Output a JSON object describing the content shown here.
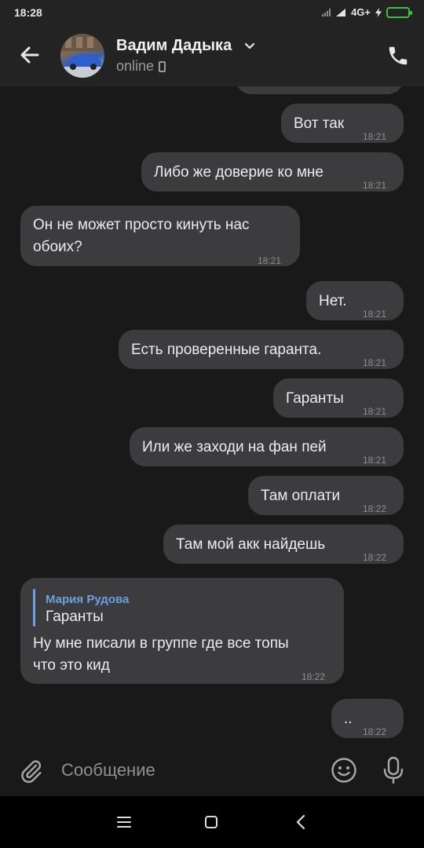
{
  "status_bar": {
    "time": "18:28",
    "network": "4G+"
  },
  "header": {
    "contact_name": "Вадим Дадыка",
    "status": "online"
  },
  "messages": [
    {
      "id": "m1",
      "direction": "out",
      "text": "Вот так",
      "time": "18:21"
    },
    {
      "id": "m2",
      "direction": "out",
      "text": "Либо же доверие ко мне",
      "time": "18:21"
    },
    {
      "id": "m3",
      "direction": "in",
      "text_lines": [
        "Он не может просто кинуть нас",
        "обоих?"
      ],
      "time": "18:21"
    },
    {
      "id": "m4",
      "direction": "out",
      "text": "Нет.",
      "time": "18:21"
    },
    {
      "id": "m5",
      "direction": "out",
      "text": "Есть проверенные гаранта.",
      "time": "18:21"
    },
    {
      "id": "m6",
      "direction": "out",
      "text": "Гаранты",
      "time": "18:21"
    },
    {
      "id": "m7",
      "direction": "out",
      "text": "Или же заходи на фан пей",
      "time": "18:21"
    },
    {
      "id": "m8",
      "direction": "out",
      "text": "Там оплати",
      "time": "18:22"
    },
    {
      "id": "m9",
      "direction": "out",
      "text": "Там мой акк найдешь",
      "time": "18:22"
    },
    {
      "id": "m10",
      "direction": "in",
      "reply": {
        "author": "Мария Рудова",
        "text": "Гаранты"
      },
      "text_lines": [
        "Ну мне писали в группе где все топы",
        "что это кид"
      ],
      "time": "18:22"
    },
    {
      "id": "m11",
      "direction": "out",
      "text": "..",
      "time": "18:22"
    }
  ],
  "composer": {
    "placeholder": "Сообщение"
  },
  "colors": {
    "background": "#19191a",
    "bar": "#232324",
    "bubble": "#3c3c3e",
    "accent": "#6c9fe0",
    "battery": "#3fbf3f"
  },
  "icons": [
    "back-arrow-icon",
    "chevron-down-icon",
    "phone-icon",
    "paperclip-icon",
    "emoji-icon",
    "microphone-icon",
    "menu-icon",
    "home-icon",
    "nav-back-icon"
  ]
}
